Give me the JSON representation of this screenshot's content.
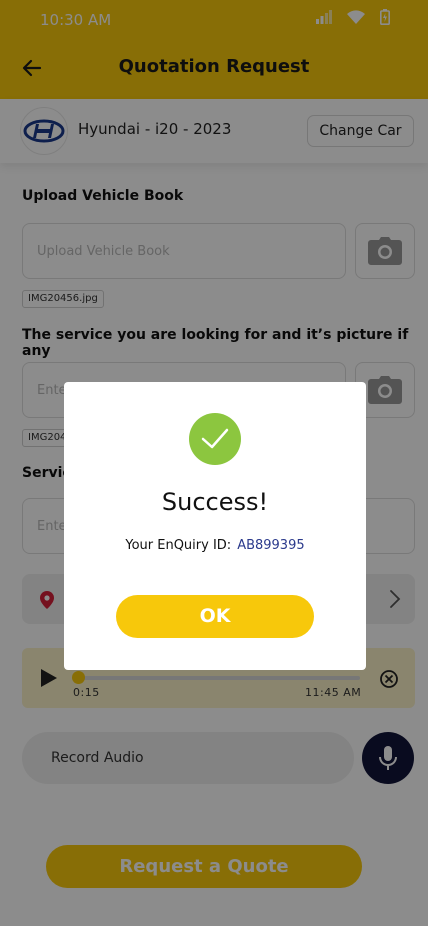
{
  "status_bar": {
    "time": "10:30 AM"
  },
  "header": {
    "title": "Quotation Request"
  },
  "car": {
    "name": "Hyundai - i20 - 2023",
    "change_label": "Change Car"
  },
  "vehicle_book": {
    "label": "Upload Vehicle Book",
    "placeholder": "Upload Vehicle Book",
    "file_name": "IMG20456.jpg"
  },
  "service_picture": {
    "label": "The service you are looking for and it’s picture if any",
    "placeholder_partial": "Ente",
    "file_partial": "IMG204"
  },
  "service_details": {
    "label_partial": "Servic",
    "placeholder_partial": "Ente"
  },
  "audio": {
    "elapsed": "0:15",
    "recorded_at": "11:45 AM",
    "progress_fraction": 0.02
  },
  "record": {
    "label": "Record Audio"
  },
  "footer": {
    "request_quote_label": "Request a Quote"
  },
  "modal": {
    "title": "Success!",
    "enquiry_label": "Your EnQuiry ID:",
    "enquiry_id": "AB899395",
    "ok_label": "OK"
  },
  "colors": {
    "accent": "#f7c80b",
    "success": "#8cc63f",
    "mic_button": "#12153a",
    "enquiry_id": "#2b3a8c"
  }
}
